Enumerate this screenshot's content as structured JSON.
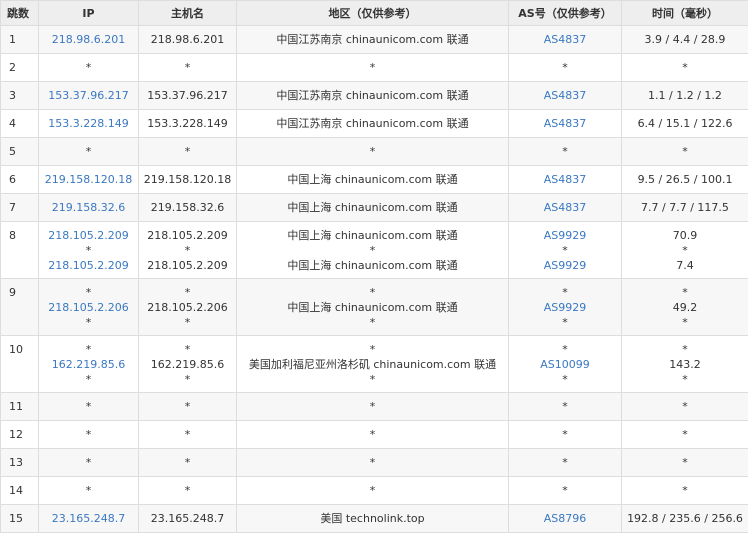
{
  "headers": [
    "跳数",
    "IP",
    "主机名",
    "地区（仅供参考）",
    "AS号（仅供参考）",
    "时间（毫秒）"
  ],
  "rows": [
    {
      "hop": "1",
      "ip": [
        "218.98.6.201"
      ],
      "host": [
        "218.98.6.201"
      ],
      "region": [
        "中国江苏南京 chinaunicom.com 联通"
      ],
      "as": [
        "AS4837"
      ],
      "time": [
        "3.9 / 4.4 / 28.9"
      ]
    },
    {
      "hop": "2",
      "ip": [
        "*"
      ],
      "host": [
        "*"
      ],
      "region": [
        "*"
      ],
      "as": [
        "*"
      ],
      "time": [
        "*"
      ]
    },
    {
      "hop": "3",
      "ip": [
        "153.37.96.217"
      ],
      "host": [
        "153.37.96.217"
      ],
      "region": [
        "中国江苏南京 chinaunicom.com 联通"
      ],
      "as": [
        "AS4837"
      ],
      "time": [
        "1.1 / 1.2 / 1.2"
      ]
    },
    {
      "hop": "4",
      "ip": [
        "153.3.228.149"
      ],
      "host": [
        "153.3.228.149"
      ],
      "region": [
        "中国江苏南京 chinaunicom.com 联通"
      ],
      "as": [
        "AS4837"
      ],
      "time": [
        "6.4 / 15.1 / 122.6"
      ]
    },
    {
      "hop": "5",
      "ip": [
        "*"
      ],
      "host": [
        "*"
      ],
      "region": [
        "*"
      ],
      "as": [
        "*"
      ],
      "time": [
        "*"
      ]
    },
    {
      "hop": "6",
      "ip": [
        "219.158.120.18"
      ],
      "host": [
        "219.158.120.18"
      ],
      "region": [
        "中国上海 chinaunicom.com 联通"
      ],
      "as": [
        "AS4837"
      ],
      "time": [
        "9.5 / 26.5 / 100.1"
      ]
    },
    {
      "hop": "7",
      "ip": [
        "219.158.32.6"
      ],
      "host": [
        "219.158.32.6"
      ],
      "region": [
        "中国上海 chinaunicom.com 联通"
      ],
      "as": [
        "AS4837"
      ],
      "time": [
        "7.7 / 7.7 / 117.5"
      ]
    },
    {
      "hop": "8",
      "ip": [
        "218.105.2.209",
        "*",
        "218.105.2.209"
      ],
      "host": [
        "218.105.2.209",
        "*",
        "218.105.2.209"
      ],
      "region": [
        "中国上海 chinaunicom.com 联通",
        "*",
        "中国上海 chinaunicom.com 联通"
      ],
      "as": [
        "AS9929",
        "*",
        "AS9929"
      ],
      "time": [
        "70.9",
        "*",
        "7.4"
      ]
    },
    {
      "hop": "9",
      "ip": [
        "*",
        "218.105.2.206",
        "*"
      ],
      "host": [
        "*",
        "218.105.2.206",
        "*"
      ],
      "region": [
        "*",
        "中国上海 chinaunicom.com 联通",
        "*"
      ],
      "as": [
        "*",
        "AS9929",
        "*"
      ],
      "time": [
        "*",
        "49.2",
        "*"
      ]
    },
    {
      "hop": "10",
      "ip": [
        "*",
        "162.219.85.6",
        "*"
      ],
      "host": [
        "*",
        "162.219.85.6",
        "*"
      ],
      "region": [
        "*",
        "美国加利福尼亚州洛杉矶 chinaunicom.com 联通",
        "*"
      ],
      "as": [
        "*",
        "AS10099",
        "*"
      ],
      "time": [
        "*",
        "143.2",
        "*"
      ]
    },
    {
      "hop": "11",
      "ip": [
        "*"
      ],
      "host": [
        "*"
      ],
      "region": [
        "*"
      ],
      "as": [
        "*"
      ],
      "time": [
        "*"
      ]
    },
    {
      "hop": "12",
      "ip": [
        "*"
      ],
      "host": [
        "*"
      ],
      "region": [
        "*"
      ],
      "as": [
        "*"
      ],
      "time": [
        "*"
      ]
    },
    {
      "hop": "13",
      "ip": [
        "*"
      ],
      "host": [
        "*"
      ],
      "region": [
        "*"
      ],
      "as": [
        "*"
      ],
      "time": [
        "*"
      ]
    },
    {
      "hop": "14",
      "ip": [
        "*"
      ],
      "host": [
        "*"
      ],
      "region": [
        "*"
      ],
      "as": [
        "*"
      ],
      "time": [
        "*"
      ]
    },
    {
      "hop": "15",
      "ip": [
        "23.165.248.7"
      ],
      "host": [
        "23.165.248.7"
      ],
      "region": [
        "美国 technolink.top"
      ],
      "as": [
        "AS8796"
      ],
      "time": [
        "192.8 / 235.6 / 256.6"
      ]
    }
  ]
}
